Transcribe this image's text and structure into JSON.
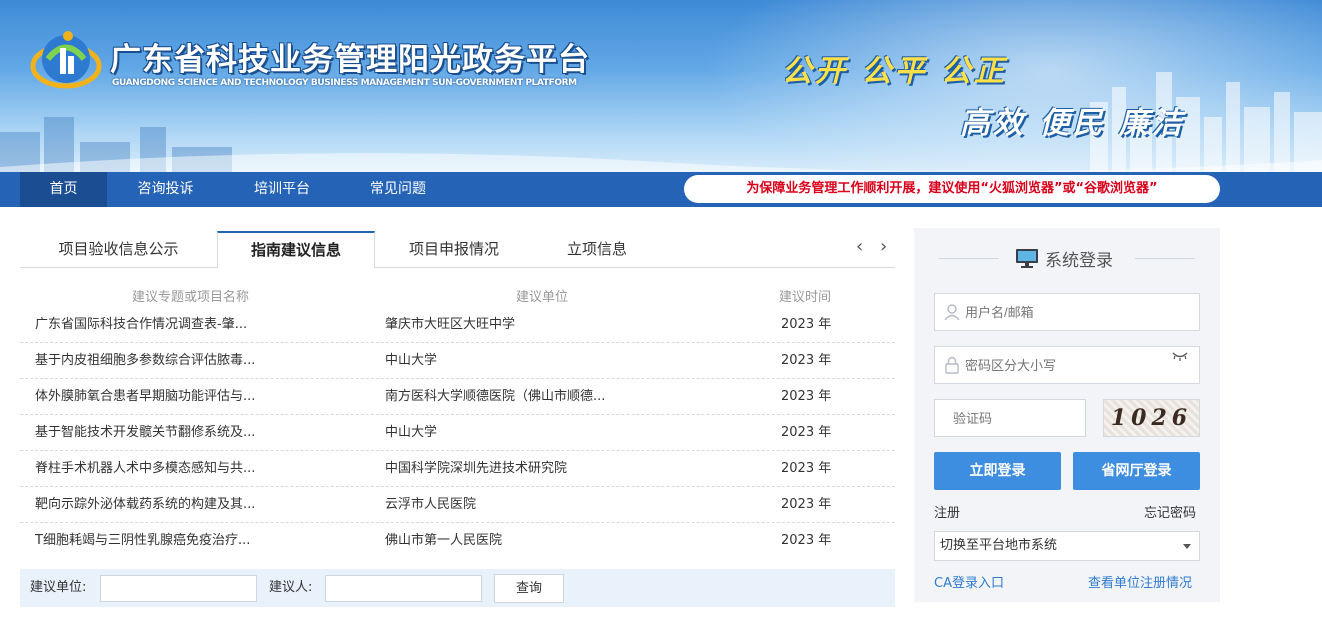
{
  "header": {
    "title_cn": "广东省科技业务管理阳光政务平台",
    "title_en": "GUANGDONG SCIENCE AND TECHNOLOGY BUSINESS MANAGEMENT SUN-GOVERNMENT PLATFORM",
    "slogan_line1": "公开 公平 公正",
    "slogan_line2": "高效 便民 廉洁"
  },
  "nav": {
    "items": [
      {
        "label": "首页",
        "active": true
      },
      {
        "label": "咨询投诉",
        "active": false
      },
      {
        "label": "培训平台",
        "active": false
      },
      {
        "label": "常见问题",
        "active": false
      }
    ],
    "notice": "为保障业务管理工作顺利开展，建议使用“火狐浏览器”或“谷歌浏览器”"
  },
  "tabs": [
    {
      "label": "项目验收信息公示",
      "active": false
    },
    {
      "label": "指南建议信息",
      "active": true
    },
    {
      "label": "项目申报情况",
      "active": false
    },
    {
      "label": "立项信息",
      "active": false
    }
  ],
  "table": {
    "headers": [
      "建议专题或项目名称",
      "建议单位",
      "建议时间"
    ],
    "rows": [
      [
        "广东省国际科技合作情况调查表-肇...",
        "肇庆市大旺区大旺中学",
        "2023 年"
      ],
      [
        "基于内皮祖细胞多参数综合评估脓毒...",
        "中山大学",
        "2023 年"
      ],
      [
        "体外膜肺氧合患者早期脑功能评估与...",
        "南方医科大学顺德医院（佛山市顺德...",
        "2023 年"
      ],
      [
        "基于智能技术开发髋关节翻修系统及...",
        "中山大学",
        "2023 年"
      ],
      [
        "脊柱手术机器人术中多模态感知与共...",
        "中国科学院深圳先进技术研究院",
        "2023 年"
      ],
      [
        "靶向示踪外泌体载药系统的构建及其...",
        "云浮市人民医院",
        "2023 年"
      ],
      [
        "T细胞耗竭与三阴性乳腺癌免疫治疗...",
        "佛山市第一人民医院",
        "2023 年"
      ]
    ]
  },
  "search": {
    "unit_label": "建议单位:",
    "person_label": "建议人:",
    "unit_value": "",
    "person_value": "",
    "button": "查询"
  },
  "login": {
    "title": "系统登录",
    "username_placeholder": "用户名/邮箱",
    "password_placeholder": "密码区分大小写",
    "captcha_placeholder": "验证码",
    "captcha_text": "1026",
    "login_button": "立即登录",
    "province_login_button": "省网厅登录",
    "register": "注册",
    "forgot": "忘记密码",
    "city_select": "切换至平台地市系统",
    "ca_link": "CA登录入口",
    "unit_register_link": "查看单位注册情况"
  },
  "colors": {
    "nav_bg": "#2563b6",
    "nav_active": "#1a4d92",
    "notice_text": "#d9001b",
    "button_blue": "#3d8ee0",
    "link_blue": "#2f7bd1"
  },
  "icons": [
    "logo-icon",
    "arrow-left-icon",
    "arrow-right-icon",
    "monitor-icon",
    "user-icon",
    "lock-icon",
    "eye-closed-icon",
    "caret-down-icon"
  ]
}
